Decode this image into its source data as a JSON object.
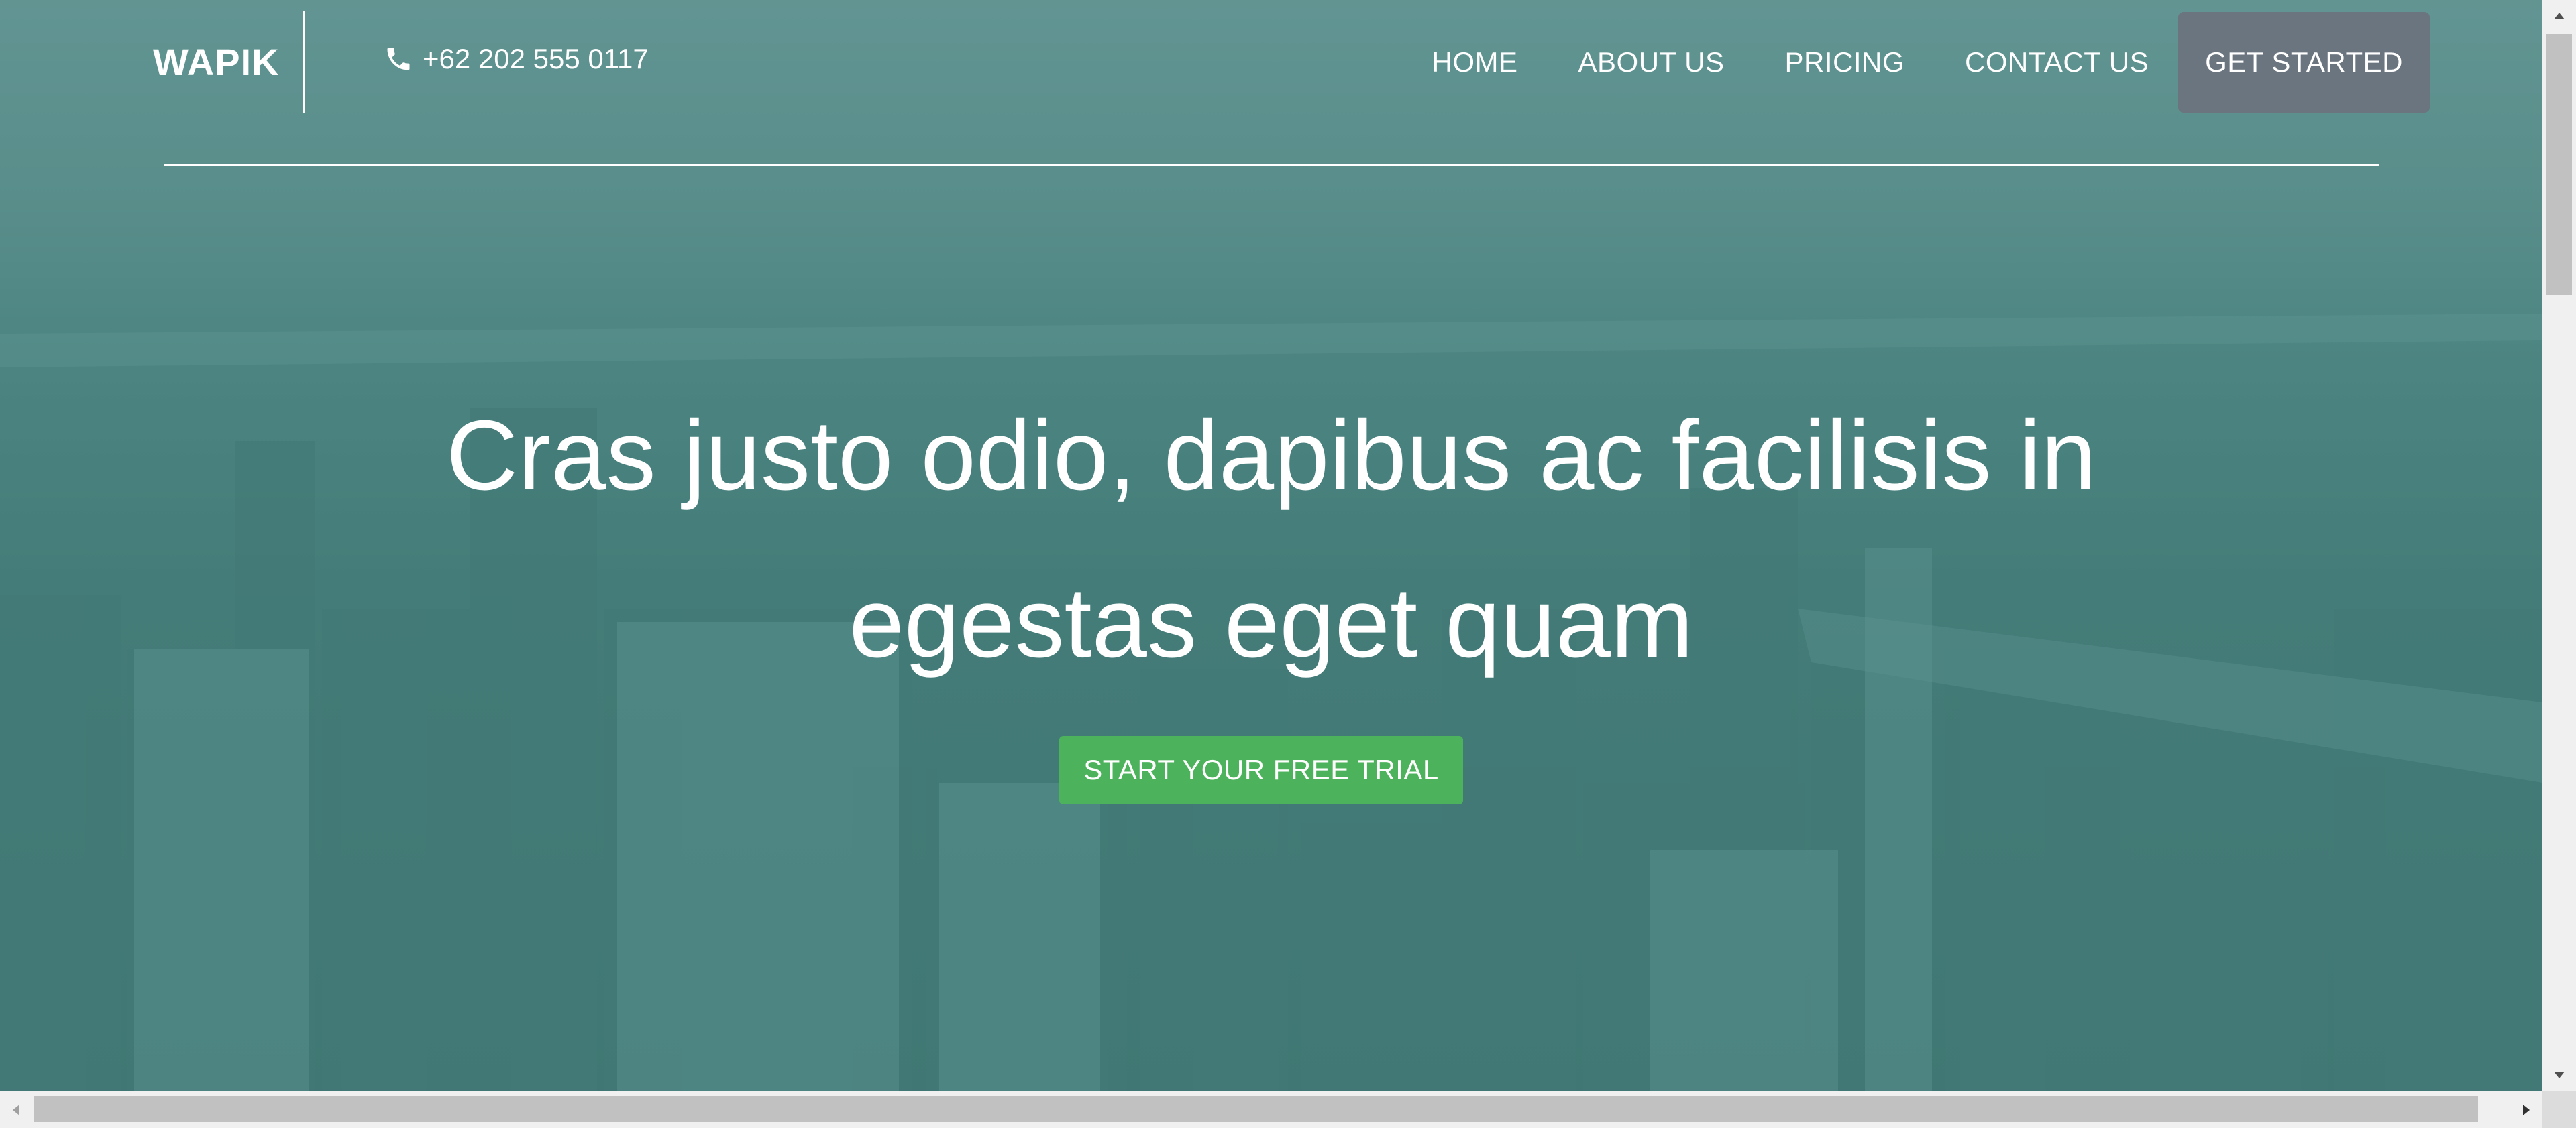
{
  "brand": {
    "logo": "WAPIK"
  },
  "contact": {
    "phone": "+62 202 555 0117",
    "phone_icon": "phone-icon"
  },
  "nav": {
    "items": [
      {
        "label": "HOME"
      },
      {
        "label": "ABOUT US"
      },
      {
        "label": "PRICING"
      },
      {
        "label": "CONTACT US"
      }
    ],
    "cta_label": "GET STARTED"
  },
  "hero": {
    "title_line1": "Cras justo odio, dapibus ac facilisis in",
    "title_line2": "egestas eget quam",
    "cta_label": "START YOUR FREE TRIAL"
  },
  "colors": {
    "overlay": "#4f8784",
    "cta_green": "#4cb35c",
    "nav_cta": "#6b7580"
  }
}
